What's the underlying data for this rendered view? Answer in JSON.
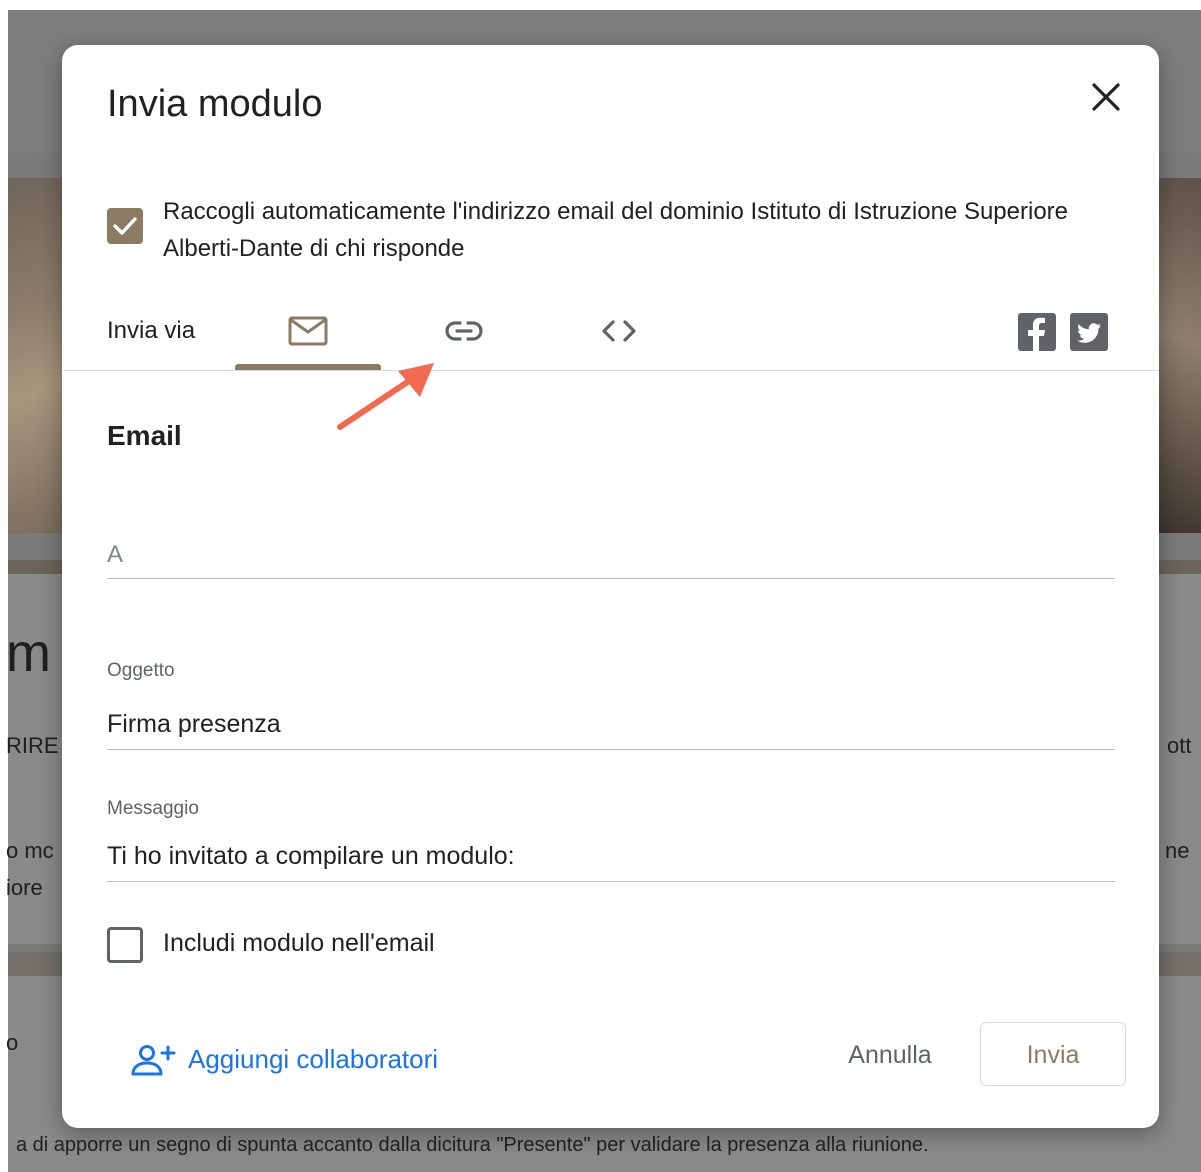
{
  "background": {
    "heading_fragment": "m",
    "left_fragment_1": "RIRE",
    "right_fragment_1": "ott",
    "left_fragment_2": "o mc",
    "right_fragment_2": "ne",
    "left_fragment_3": "iore",
    "bottom_left_fragment": "o",
    "footer_text": "a di apporre un segno di spunta accanto dalla dicitura \"Presente\" per validare la presenza alla riunione."
  },
  "dialog": {
    "title": "Invia modulo",
    "collect_email": {
      "checked": true,
      "label": "Raccogli automaticamente l'indirizzo email del dominio Istituto di Istruzione Superiore Alberti-Dante di chi risponde"
    },
    "send_via_label": "Invia via",
    "tabs": [
      {
        "icon": "mail-icon",
        "active": true
      },
      {
        "icon": "link-icon",
        "active": false
      },
      {
        "icon": "embed-code-icon",
        "active": false
      }
    ],
    "share_icons": [
      "facebook-icon",
      "twitter-icon"
    ],
    "section_title": "Email",
    "to_field": {
      "placeholder": "A",
      "value": ""
    },
    "subject_field": {
      "label": "Oggetto",
      "value": "Firma presenza"
    },
    "message_field": {
      "label": "Messaggio",
      "value": "Ti ho invitato a compilare un modulo:"
    },
    "include_form": {
      "checked": false,
      "label": "Includi modulo nell'email"
    },
    "add_collaborators": "Aggiungi collaboratori",
    "cancel_label": "Annulla",
    "send_label": "Invia"
  },
  "colors": {
    "accent": "#8b7b62",
    "link_blue": "#1a73e8",
    "annotation_arrow": "#f26b50"
  }
}
